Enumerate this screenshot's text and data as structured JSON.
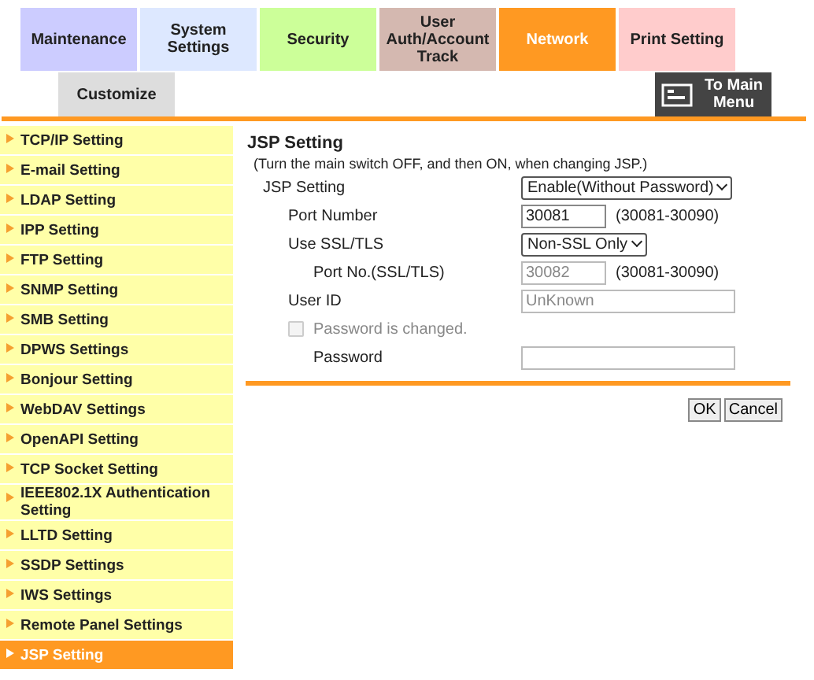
{
  "tabs": [
    {
      "label": "Maintenance",
      "color": "#ccccff",
      "selected": false
    },
    {
      "label": "System Settings",
      "color": "#dde8ff",
      "selected": false
    },
    {
      "label": "Security",
      "color": "#ccff99",
      "selected": false
    },
    {
      "label": "User Auth/Account Track",
      "color": "#d4b8b0",
      "selected": false
    },
    {
      "label": "Network",
      "color": "#ff9922",
      "selected": true
    },
    {
      "label": "Print Setting",
      "color": "#ffcccc",
      "selected": false
    },
    {
      "label": "Customize",
      "color": "#dddddd",
      "selected": false
    }
  ],
  "main_menu_button": {
    "label": "To Main Menu"
  },
  "sidebar": {
    "items": [
      {
        "label": "TCP/IP Setting",
        "selected": false
      },
      {
        "label": "E-mail Setting",
        "selected": false
      },
      {
        "label": "LDAP Setting",
        "selected": false
      },
      {
        "label": "IPP Setting",
        "selected": false
      },
      {
        "label": "FTP Setting",
        "selected": false
      },
      {
        "label": "SNMP Setting",
        "selected": false
      },
      {
        "label": "SMB Setting",
        "selected": false
      },
      {
        "label": "DPWS Settings",
        "selected": false
      },
      {
        "label": "Bonjour Setting",
        "selected": false
      },
      {
        "label": "WebDAV Settings",
        "selected": false
      },
      {
        "label": "OpenAPI Setting",
        "selected": false
      },
      {
        "label": "TCP Socket Setting",
        "selected": false
      },
      {
        "label": "IEEE802.1X Authentication Setting",
        "selected": false
      },
      {
        "label": "LLTD Setting",
        "selected": false
      },
      {
        "label": "SSDP Settings",
        "selected": false
      },
      {
        "label": "IWS Settings",
        "selected": false
      },
      {
        "label": "Remote Panel Settings",
        "selected": false
      },
      {
        "label": "JSP Setting",
        "selected": true
      }
    ]
  },
  "content": {
    "title": "JSP Setting",
    "note": "(Turn the main switch OFF, and then ON, when changing JSP.)",
    "fields": [
      {
        "kind": "select",
        "label": "JSP Setting",
        "value": "Enable(Without Password)",
        "disabled": false,
        "children": [
          {
            "kind": "text",
            "label": "Port Number",
            "value": "30081",
            "range": "(30081-30090)",
            "disabled": false
          },
          {
            "kind": "select",
            "label": "Use SSL/TLS",
            "value": "Non-SSL Only",
            "disabled": false,
            "children": [
              {
                "kind": "text",
                "label": "Port No.(SSL/TLS)",
                "value": "30082",
                "range": "(30081-30090)",
                "disabled": true
              }
            ]
          },
          {
            "kind": "wide",
            "label": "User ID",
            "value": "UnKnown",
            "disabled": true
          },
          {
            "kind": "checkbox",
            "label": "Password is changed.",
            "checked": false,
            "disabled": true,
            "children": [
              {
                "kind": "password",
                "label": "Password",
                "disabled": true
              }
            ]
          }
        ]
      }
    ],
    "buttons": [
      "OK",
      "Cancel"
    ]
  }
}
